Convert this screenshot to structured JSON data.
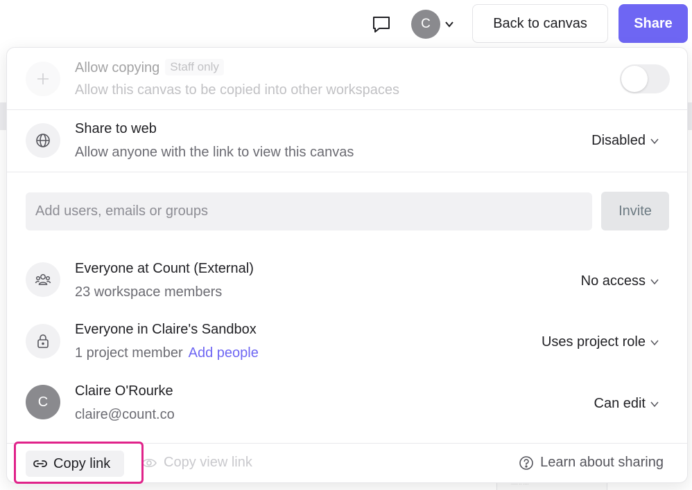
{
  "topbar": {
    "avatar_initial": "C",
    "back_label": "Back to canvas",
    "share_label": "Share"
  },
  "panel": {
    "allow_copying": {
      "title": "Allow copying",
      "badge": "Staff only",
      "subtitle": "Allow this canvas to be copied into other workspaces",
      "toggle_on": false
    },
    "share_to_web": {
      "title": "Share to web",
      "subtitle": "Allow anyone with the link to view this canvas",
      "value": "Disabled"
    },
    "invite": {
      "placeholder": "Add users, emails or groups",
      "button_label": "Invite"
    },
    "members": [
      {
        "title": "Everyone at Count (External)",
        "subtitle": "23 workspace members",
        "role": "No access"
      },
      {
        "title": "Everyone in Claire's Sandbox",
        "subtitle": "1 project member",
        "link": "Add people",
        "role": "Uses project role"
      },
      {
        "initial": "C",
        "title": "Claire O'Rourke",
        "subtitle": "claire@count.co",
        "role": "Can edit"
      }
    ],
    "footer": {
      "copy_link": "Copy link",
      "copy_view_link": "Copy view link",
      "learn": "Learn about sharing"
    }
  },
  "colors": {
    "accent": "#6e66f3",
    "highlight": "#e0238a"
  }
}
